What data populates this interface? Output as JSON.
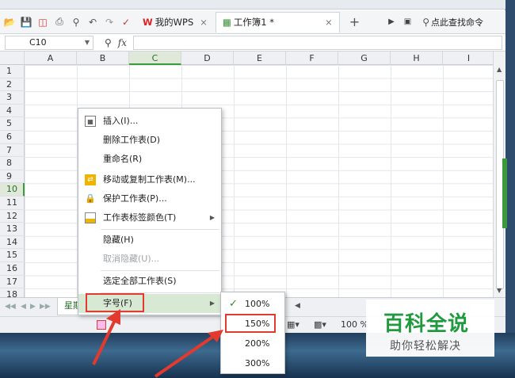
{
  "toolbar": {
    "icons": [
      "open-icon",
      "save-icon",
      "pdf-icon",
      "print-icon",
      "preview-icon",
      "undo-icon",
      "redo-icon",
      "format-brush-icon"
    ],
    "tabs": [
      {
        "label": "我的WPS",
        "close": "×"
      },
      {
        "label": "工作簿1 *",
        "close": "×"
      }
    ],
    "new_tab": "+",
    "search_label": "点此查找命令"
  },
  "formula_bar": {
    "cell_ref": "C10",
    "fx_label": "fx"
  },
  "columns": [
    "A",
    "B",
    "C",
    "D",
    "E",
    "F",
    "G",
    "H",
    "I"
  ],
  "selected_column": "C",
  "rows": [
    "1",
    "2",
    "3",
    "4",
    "5",
    "6",
    "7",
    "8",
    "9",
    "10",
    "11",
    "12",
    "13",
    "14",
    "15",
    "16",
    "17",
    "18"
  ],
  "selected_row": "10",
  "sheet_tab": {
    "label": "星期"
  },
  "status": {
    "zoom": "100 %"
  },
  "context_menu": {
    "items": [
      {
        "label": "插入(I)...",
        "icon": "insert-icon"
      },
      {
        "label": "删除工作表(D)"
      },
      {
        "label": "重命名(R)"
      },
      {
        "label": "移动或复制工作表(M)...",
        "icon": "move-copy-icon"
      },
      {
        "label": "保护工作表(P)...",
        "icon": "protect-icon"
      },
      {
        "label": "工作表标签颜色(T)",
        "icon": "tab-color-icon",
        "submenu": true
      },
      {
        "label": "隐藏(H)"
      },
      {
        "label": "取消隐藏(U)...",
        "disabled": true
      },
      {
        "label": "选定全部工作表(S)"
      },
      {
        "label": "字号(F)",
        "submenu": true,
        "highlighted": true
      }
    ]
  },
  "font_size_submenu": {
    "items": [
      {
        "label": "100%",
        "checked": true
      },
      {
        "label": "150%",
        "outlined": true
      },
      {
        "label": "200%"
      },
      {
        "label": "300%"
      }
    ]
  },
  "watermark": {
    "title": "百科全说",
    "subtitle": "助你轻松解决"
  },
  "colors": {
    "accent_green": "#3c9a3c",
    "highlight_red": "#e23a2e",
    "watermark_green": "#1f9a3e"
  }
}
